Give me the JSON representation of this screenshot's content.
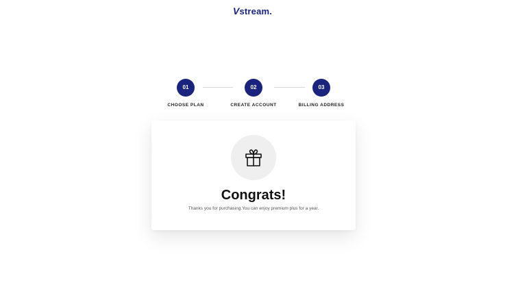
{
  "brand": {
    "logo_mark": "V",
    "logo_text": "stream",
    "logo_dot": ".",
    "color": "#1a237e"
  },
  "steps": [
    {
      "number": "01",
      "label": "CHOOSE PLAN"
    },
    {
      "number": "02",
      "label": "CREATE ACCOUNT"
    },
    {
      "number": "03",
      "label": "BILLING ADDRESS"
    }
  ],
  "card": {
    "icon": "gift-icon",
    "title": "Congrats!",
    "message": "Thanks you for purchasing.You can enjoy premium plus for a year."
  }
}
